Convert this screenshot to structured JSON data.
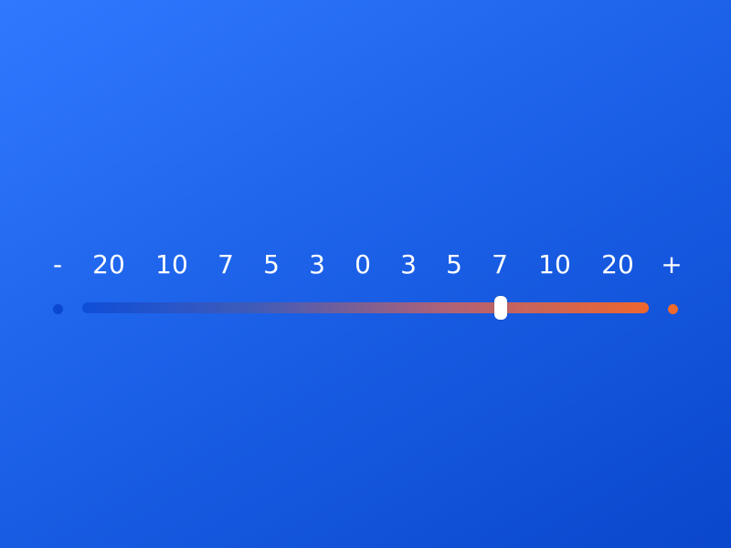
{
  "slider": {
    "minus_label": "-",
    "plus_label": "+",
    "scale": [
      "20",
      "10",
      "7",
      "5",
      "3",
      "0",
      "3",
      "5",
      "7",
      "10",
      "20"
    ],
    "selected_index": 9,
    "thumb_fraction": 0.738,
    "colors": {
      "negative": "#0f4ed8",
      "positive": "#ee662e",
      "negative_dot": "#0b47cf",
      "positive_dot": "#ef6a2c",
      "thumb": "#ffffff"
    }
  }
}
